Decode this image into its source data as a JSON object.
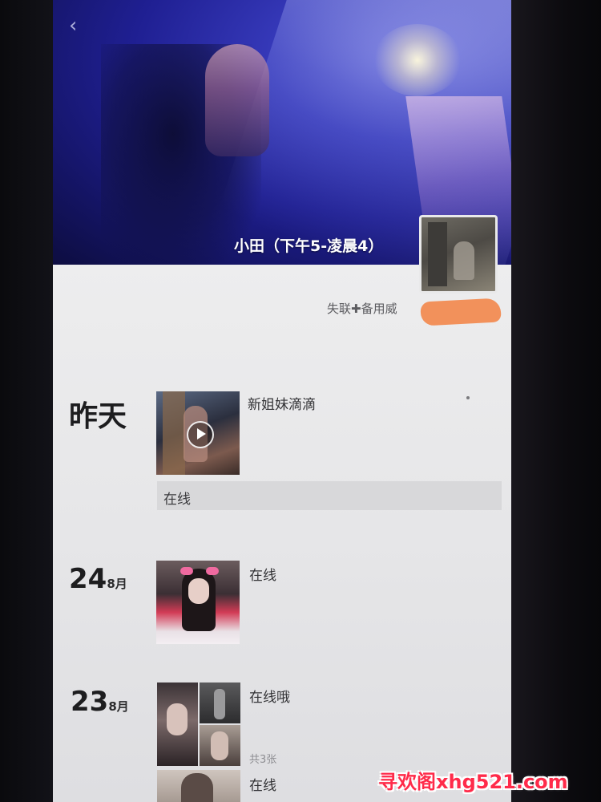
{
  "header": {
    "back_glyph": "‹",
    "profile_name": "小田（下午5-凌晨4）"
  },
  "profile": {
    "signature": "失联✚备用威"
  },
  "feed": [
    {
      "date_label": "昨天",
      "post_text": "新姐妹滴滴",
      "status": "在线",
      "thumb_type": "video"
    },
    {
      "day": "24",
      "month": "8月",
      "post_text": "在线"
    },
    {
      "day": "23",
      "month": "8月",
      "post_text": "在线哦",
      "photo_count": "共3张"
    },
    {
      "post_text": "在线"
    }
  ],
  "watermark": "寻欢阁xhg521.com",
  "colors": {
    "cover_blue": "#2a2ca8",
    "panel_bg": "#e9e9eb",
    "text_dark": "#1d1d1f",
    "scribble": "#f28c53",
    "watermark_red": "#ff2b4a"
  }
}
